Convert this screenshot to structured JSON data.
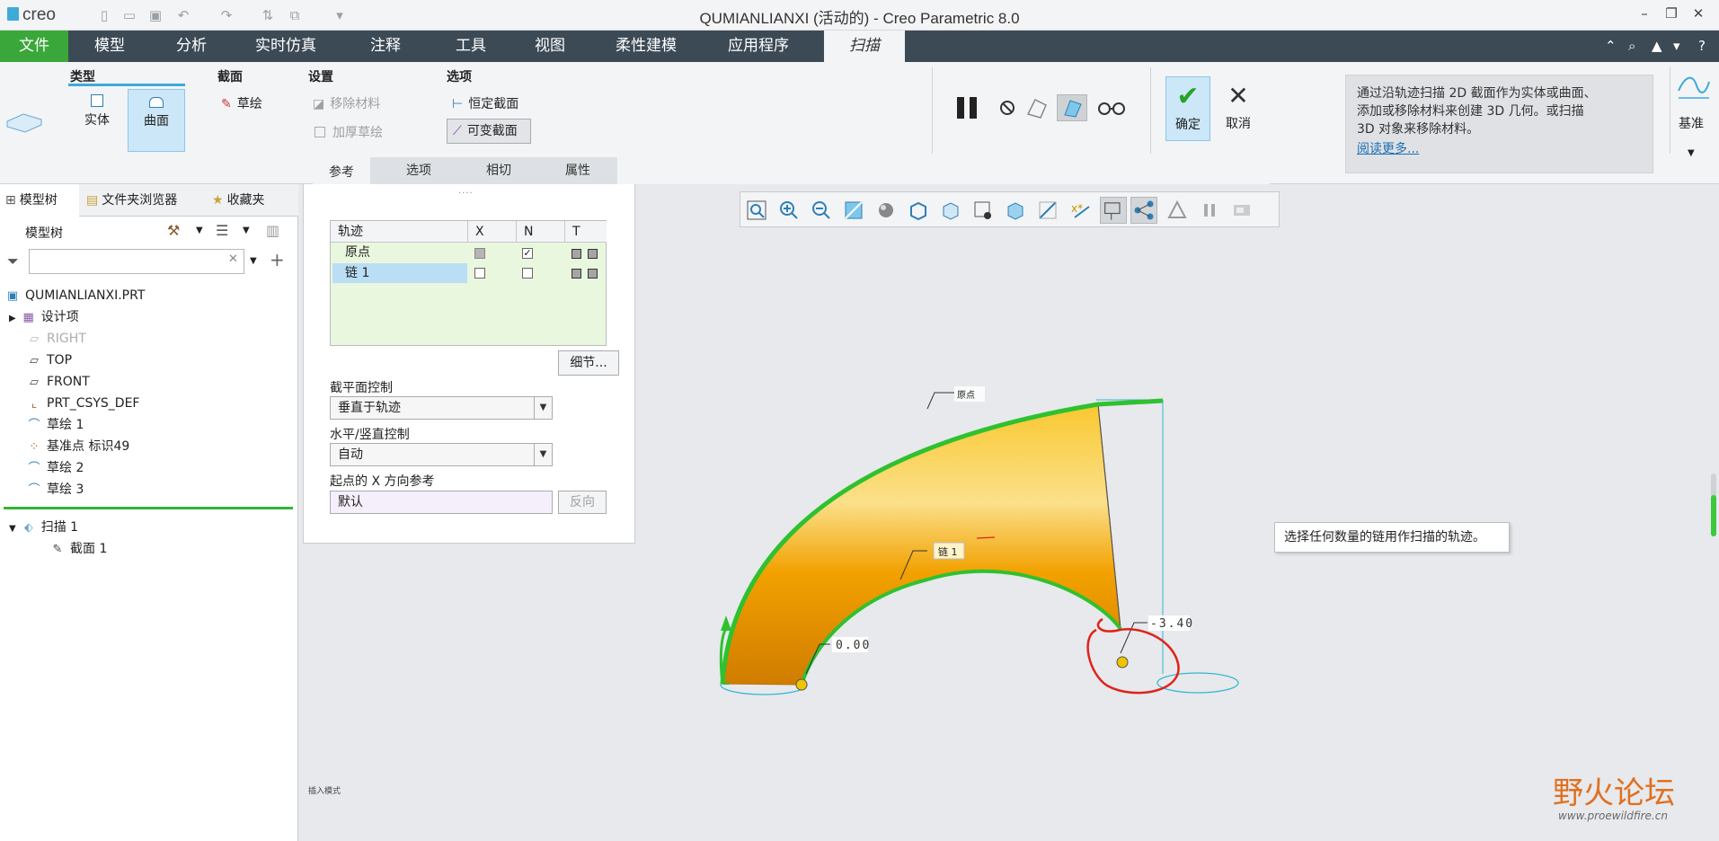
{
  "app": {
    "logo": "creo",
    "window_title": "QUMIANLIANXI (活动的) - Creo Parametric 8.0"
  },
  "menubar": {
    "items": [
      "文件",
      "模型",
      "分析",
      "实时仿真",
      "注释",
      "工具",
      "视图",
      "柔性建模",
      "应用程序",
      "扫描"
    ]
  },
  "ribbon": {
    "type_group": {
      "title": "类型",
      "solid": "实体",
      "surface": "曲面"
    },
    "section_group": {
      "title": "截面",
      "sketch": "草绘"
    },
    "settings_group": {
      "title": "设置",
      "remove_material": "移除材料",
      "thicken_sketch": "加厚草绘"
    },
    "options_group": {
      "title": "选项",
      "constant_section": "恒定截面",
      "variable_section": "可变截面"
    },
    "ok": "确定",
    "cancel": "取消",
    "datum": "基准",
    "help_text": "通过沿轨迹扫描 2D 截面作为实体或曲面、添加或移除材料来创建 3D 几何。或扫描 3D 对象来移除材料。",
    "help_line1": "通过沿轨迹扫描 2D 截面作为实体或曲面、",
    "help_line2": "添加或移除材料来创建 3D 几何。或扫描",
    "help_line3": "3D 对象来移除材料。",
    "help_link": "阅读更多...",
    "tabs": [
      "参考",
      "选项",
      "相切",
      "属性"
    ]
  },
  "leftpanel": {
    "tabs": [
      "模型树",
      "文件夹浏览器",
      "收藏夹"
    ],
    "tree_header": "模型树",
    "tree": [
      {
        "label": "QUMIANLIANXI.PRT",
        "icon": "part-icon"
      },
      {
        "label": "设计项",
        "icon": "design-items-icon"
      },
      {
        "label": "RIGHT",
        "icon": "datum-plane-icon"
      },
      {
        "label": "TOP",
        "icon": "datum-plane-icon"
      },
      {
        "label": "FRONT",
        "icon": "datum-plane-icon"
      },
      {
        "label": "PRT_CSYS_DEF",
        "icon": "csys-icon"
      },
      {
        "label": "草绘 1",
        "icon": "sketch-icon"
      },
      {
        "label": "基准点 标识49",
        "icon": "datum-point-icon"
      },
      {
        "label": "草绘 2",
        "icon": "sketch-icon"
      },
      {
        "label": "草绘 3",
        "icon": "sketch-icon"
      },
      {
        "label": "扫描 1",
        "icon": "sweep-icon"
      },
      {
        "label": "截面 1",
        "icon": "section-icon"
      }
    ]
  },
  "refpanel": {
    "collector_headers": [
      "轨迹",
      "X",
      "N",
      "T"
    ],
    "rows": [
      {
        "name": "原点",
        "x": "gray",
        "n": "checked"
      },
      {
        "name": "链 1",
        "x": "unchecked",
        "n": "unchecked"
      }
    ],
    "details_button": "细节...",
    "section_plane_label": "截平面控制",
    "section_plane_value": "垂直于轨迹",
    "hv_label": "水平/竖直控制",
    "hv_value": "自动",
    "xref_label": "起点的 X 方向参考",
    "xref_value": "默认",
    "flip_button": "反向"
  },
  "graphics": {
    "hint": "选择任何数量的链用作扫描的轨迹。",
    "label_origin": "原点",
    "label_chain": "链 1",
    "dim_start": "0.00",
    "dim_end": "-3.40",
    "status": "插入模式",
    "watermark_cn": "野火论坛",
    "watermark_url": "www.proewildfire.cn",
    "colors": {
      "surface": "#f2a100",
      "trajectory": "#2fc12f",
      "construction": "#36b7d4",
      "annotation": "#e0221a"
    }
  }
}
